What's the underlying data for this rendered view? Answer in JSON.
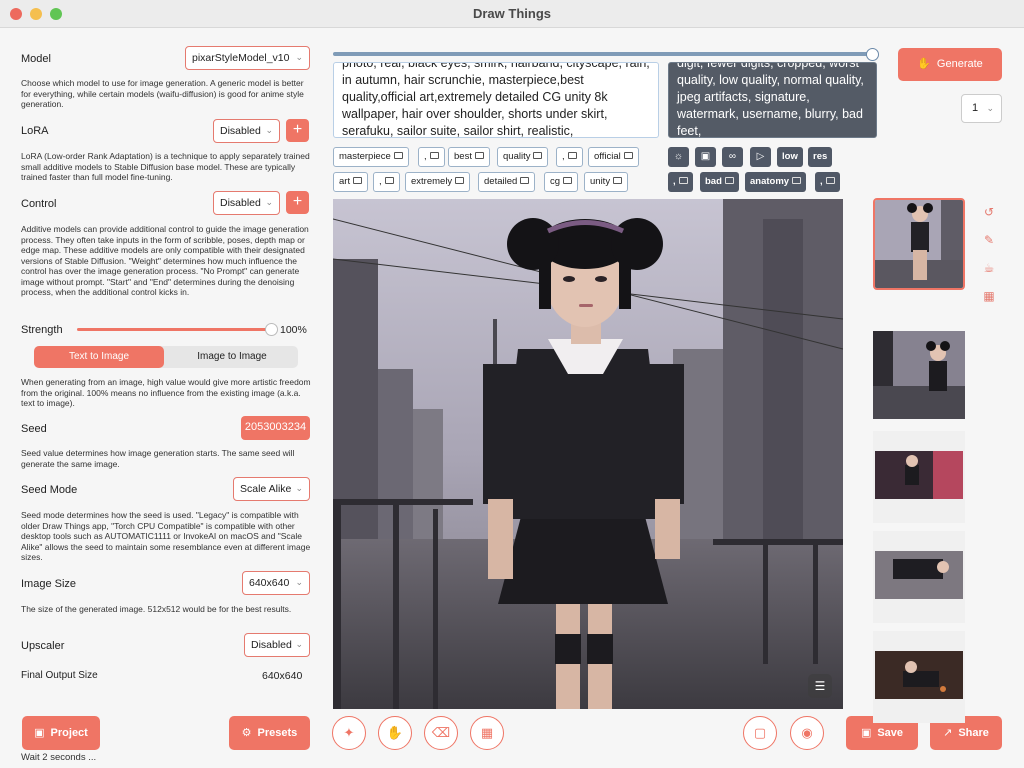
{
  "window": {
    "title": "Draw Things"
  },
  "settings": {
    "model": {
      "label": "Model",
      "value": "pixarStyleModel_v10",
      "description": "Choose which model to use for image generation. A generic model is better for everything, while certain models (waifu-diffusion) is good for anime style generation."
    },
    "lora": {
      "label": "LoRA",
      "value": "Disabled",
      "description": "LoRA (Low-order Rank Adaptation) is a technique to apply separately trained small additive models to Stable Diffusion base model. These are typically trained faster than full model fine-tuning."
    },
    "control": {
      "label": "Control",
      "value": "Disabled",
      "description": "Additive models can provide additional control to guide the image generation process. They often take inputs in the form of scribble, poses, depth map or edge map. These additive models are only compatible with their designated versions of Stable Diffusion. \"Weight\" determines how much influence the control has over the image generation process. \"No Prompt\" can generate image without prompt. \"Start\" and \"End\" determines during the denoising process, when the additional control kicks in."
    },
    "strength": {
      "label": "Strength",
      "value": "100%",
      "level": 1.0,
      "description": "When generating from an image, high value would give more artistic freedom from the original. 100% means no influence from the existing image (a.k.a. text to image)."
    },
    "mode": {
      "text_to_image": "Text to Image",
      "image_to_image": "Image to Image"
    },
    "seed": {
      "label": "Seed",
      "value": "2053003234",
      "description": "Seed value determines how image generation starts. The same seed will generate the same image."
    },
    "seed_mode": {
      "label": "Seed Mode",
      "value": "Scale Alike",
      "description": "Seed mode determines how the seed is used. \"Legacy\" is compatible with older Draw Things app, \"Torch CPU Compatible\" is compatible with other desktop tools such as AUTOMATIC1111 or InvokeAI on macOS and \"Scale Alike\" allows the seed to maintain some resemblance even at different image sizes."
    },
    "image_size": {
      "label": "Image Size",
      "value": "640x640",
      "description": "The size of the generated image. 512x512 would be for the best results."
    },
    "upscaler": {
      "label": "Upscaler",
      "value": "Disabled"
    },
    "final_output": {
      "label": "Final Output Size",
      "value": "640x640"
    }
  },
  "buttons": {
    "project": "Project",
    "presets": "Presets",
    "generate": "Generate",
    "save": "Save",
    "share": "Share"
  },
  "status": "Wait 2 seconds ...",
  "progress": 1.0,
  "batch_count": "1",
  "prompt": {
    "positive": "photo, real, black eyes, smirk, hairband, cityscape, rain, in autumn, hair scrunchie, masterpiece,best quality,official art,extremely detailed CG unity 8k wallpaper, hair over shoulder, shorts under skirt, serafuku, sailor suite, sailor shirt, realistic,",
    "negative": "digit, fewer digits, cropped, worst quality, low quality, normal quality, jpeg artifacts, signature, watermark, username, blurry, bad feet,"
  },
  "positive_tags": [
    [
      "masterpiece",
      ",",
      "best",
      "quality",
      ",",
      "official"
    ],
    [
      "art",
      ",",
      "extremely",
      "detailed",
      "cg",
      "unity"
    ]
  ],
  "negative_tags": {
    "row1_words": [
      "low",
      "res"
    ],
    "row2": [
      ",",
      "bad",
      "anatomy",
      ","
    ]
  },
  "icons": {
    "generate": "hand-icon",
    "project": "folder-icon",
    "presets": "gear-icon",
    "save": "image-icon",
    "share": "share-icon",
    "layers": "layers-icon",
    "history": "history-icon",
    "edit": "brush-icon",
    "coffee": "coffee-icon",
    "grid": "grid-icon"
  },
  "colors": {
    "accent": "#ef7565",
    "negative_bg": "#545b66",
    "progress": "#7f9bb7"
  }
}
